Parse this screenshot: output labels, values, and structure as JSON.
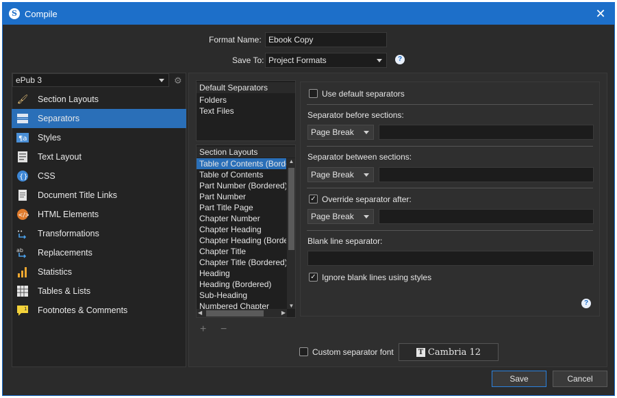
{
  "window": {
    "title": "Compile",
    "app_icon": "S"
  },
  "format": {
    "name_label": "Format Name:",
    "name_value": "Ebook Copy",
    "saveto_label": "Save To:",
    "saveto_value": "Project Formats"
  },
  "format_select": {
    "value": "ePub 3"
  },
  "sidebar": {
    "items": [
      {
        "label": "Section Layouts",
        "icon": "brush-icon"
      },
      {
        "label": "Separators",
        "icon": "separators-icon"
      },
      {
        "label": "Styles",
        "icon": "styles-icon"
      },
      {
        "label": "Text Layout",
        "icon": "text-layout-icon"
      },
      {
        "label": "CSS",
        "icon": "css-icon"
      },
      {
        "label": "Document Title Links",
        "icon": "document-icon"
      },
      {
        "label": "HTML Elements",
        "icon": "html-icon"
      },
      {
        "label": "Transformations",
        "icon": "transform-icon"
      },
      {
        "label": "Replacements",
        "icon": "replace-icon"
      },
      {
        "label": "Statistics",
        "icon": "chart-icon"
      },
      {
        "label": "Tables & Lists",
        "icon": "table-icon"
      },
      {
        "label": "Footnotes & Comments",
        "icon": "note-icon"
      }
    ],
    "selected": "Separators"
  },
  "default_separators": {
    "header": "Default Separators",
    "items": [
      "Folders",
      "Text Files"
    ]
  },
  "section_layouts": {
    "header": "Section Layouts",
    "items": [
      "Table of Contents (Bordered)",
      "Table of Contents",
      "Part Number (Bordered)",
      "Part Number",
      "Part Title Page",
      "Chapter Number",
      "Chapter Heading",
      "Chapter Heading (Bordered)",
      "Chapter Title",
      "Chapter Title (Bordered)",
      "Heading",
      "Heading (Bordered)",
      "Sub-Heading",
      "Numbered Chapter"
    ]
  },
  "list_controls": {
    "add": "+",
    "remove": "−"
  },
  "separators": {
    "use_default_label": "Use default separators",
    "before_label": "Separator before sections:",
    "before_value": "Page Break",
    "between_label": "Separator between sections:",
    "between_value": "Page Break",
    "override_label": "Override separator after:",
    "override_value": "Page Break",
    "blank_label": "Blank line separator:",
    "ignore_label": "Ignore blank lines using styles",
    "use_default_checked": false,
    "override_checked": true,
    "ignore_checked": true
  },
  "custom_font": {
    "label": "Custom separator font",
    "button": "Cambria 12",
    "checked": false
  },
  "buttons": {
    "save": "Save",
    "cancel": "Cancel"
  },
  "colors": {
    "accent": "#1d6fc9",
    "selection": "#2a6fb8"
  }
}
